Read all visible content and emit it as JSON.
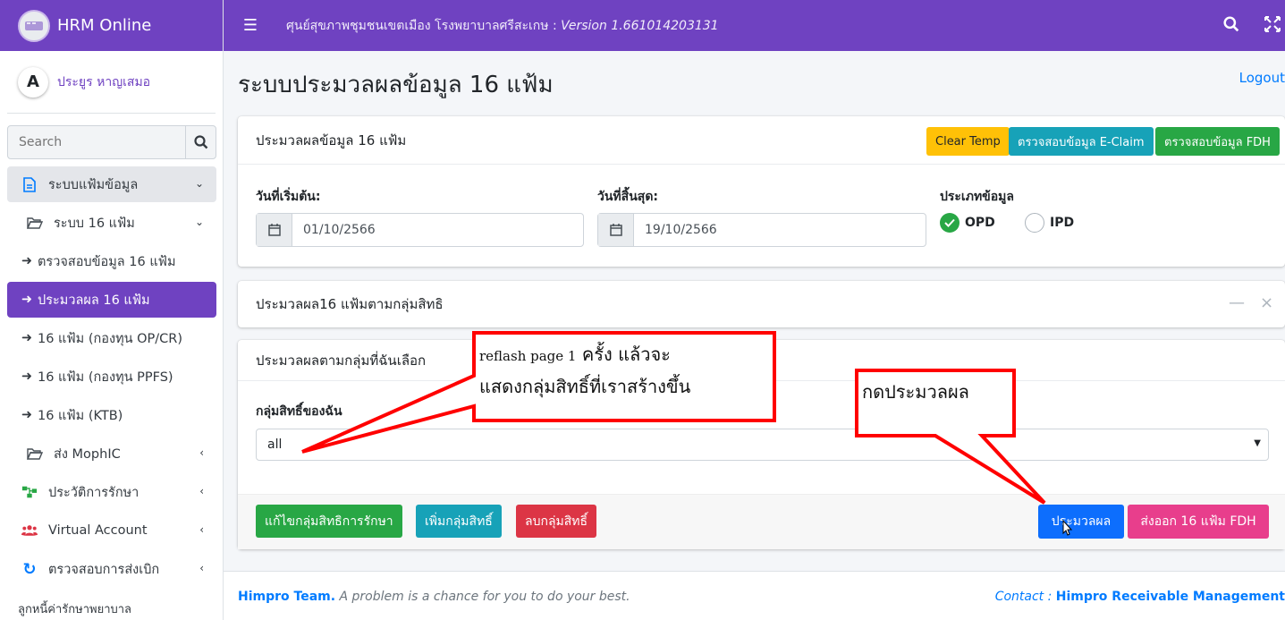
{
  "app": {
    "brand": "HRM Online",
    "user": "ประยูร หาญเสมอ",
    "user_initial": "A"
  },
  "topbar": {
    "title": "ศุนย์สุขภาพชุมชนเขตเมือง โรงพยาบาลศรีสะเกษ : ",
    "version": "Version 1.661014203131"
  },
  "sidebar": {
    "search_placeholder": "Search",
    "items": [
      {
        "label": "ระบบแฟ้มข้อมูล"
      },
      {
        "label": "ระบบ 16 แฟ้ม"
      },
      {
        "label": "ตรวจสอบข้อมูล 16 แฟ้ม"
      },
      {
        "label": "ประมวลผล 16 แฟ้ม"
      },
      {
        "label": "16 แฟ้ม (กองทุน OP/CR)"
      },
      {
        "label": "16 แฟ้ม (กองทุน PPFS)"
      },
      {
        "label": "16 แฟ้ม (KTB)"
      },
      {
        "label": "ส่ง MophIC"
      },
      {
        "label": "ประวัติการรักษา"
      },
      {
        "label": "Virtual Account"
      },
      {
        "label": "ตรวจสอบการส่งเบิก"
      }
    ],
    "footer_item": "ลูกหนี้ค่ารักษาพยาบาล"
  },
  "page": {
    "title": "ระบบประมวลผลข้อมูล 16 แฟ้ม",
    "logout": "Logout"
  },
  "card1": {
    "title": "ประมวลผลข้อมูล 16 แฟ้ม",
    "btn_clear": "Clear Temp",
    "btn_eclaim": "ตรวจสอบข้อมูล E-Claim",
    "btn_fdh": "ตรวจสอบข้อมูล FDH",
    "start_label": "วันที่เริ่มต้น:",
    "start_value": "01/10/2566",
    "end_label": "วันที่สิ้นสุด:",
    "end_value": "19/10/2566",
    "type_label": "ประเภทข้อมูล",
    "opd": "OPD",
    "ipd": "IPD"
  },
  "card2": {
    "title": "ประมวลผล16 แฟ้มตามกลุ่มสิทธิ"
  },
  "card3": {
    "title": "ประมวลผลตามกลุ่มที่ฉันเลือก",
    "group_label": "กลุ่มสิทธิ์ของฉัน",
    "group_value": "all",
    "btn_edit": "แก้ไขกลุ่มสิทธิการรักษา",
    "btn_add": "เพิ่มกลุ่มสิทธิ์",
    "btn_delete": "ลบกลุ่มสิทธิ์",
    "btn_process": "ประมวลผล",
    "btn_export": "ส่งออก 16 แฟ้ม FDH"
  },
  "callouts": {
    "left_line1_small": "reflash page 1",
    "left_line1_big": " ครั้ง แล้วจะ",
    "left_line2": "แสดงกลุ่มสิทธิ์ที่เราสร้างขึ้น",
    "right": "กดประมวลผล"
  },
  "footer": {
    "team": "Himpro Team.",
    "tagline": " A problem is a chance for you to do your best.",
    "contact_label": "Contact : ",
    "contact_value": "Himpro Receivable Management"
  },
  "colors": {
    "primary": "#6f42c1",
    "callout": "#ff0000"
  }
}
